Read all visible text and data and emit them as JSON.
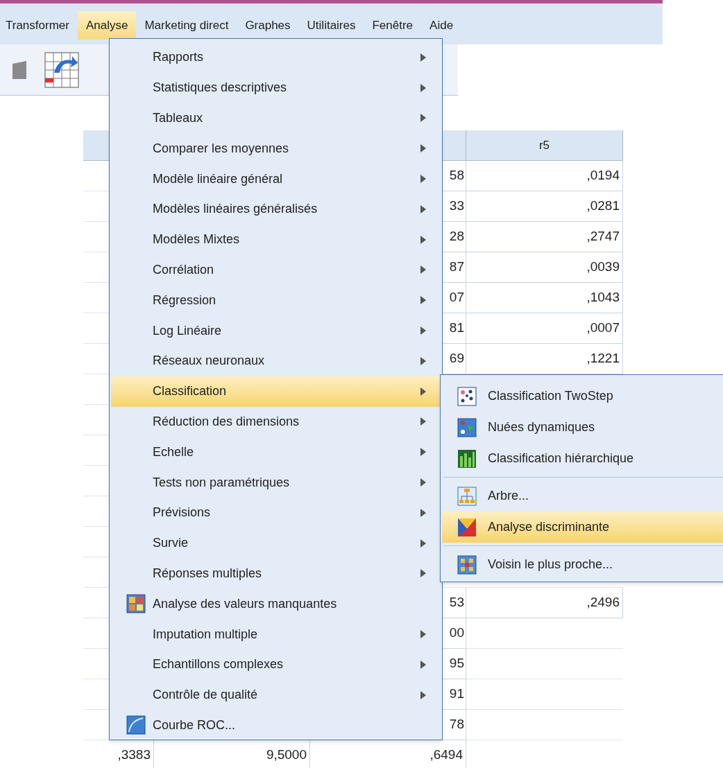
{
  "menu_bar": [
    {
      "label": "Transformer",
      "selected": false
    },
    {
      "label": "Analyse",
      "selected": true
    },
    {
      "label": "Marketing direct",
      "selected": false
    },
    {
      "label": "Graphes",
      "selected": false
    },
    {
      "label": "Utilitaires",
      "selected": false
    },
    {
      "label": "Fenêtre",
      "selected": false
    },
    {
      "label": "Aide",
      "selected": false
    }
  ],
  "grid": {
    "column_4_header": "r5",
    "rows_top": [
      {
        "column_3": "58",
        "column_4": ",0194"
      },
      {
        "column_3": "33",
        "column_4": ",0281"
      },
      {
        "column_3": "28",
        "column_4": ",2747"
      },
      {
        "column_3": "87",
        "column_4": ",0039"
      },
      {
        "column_3": "07",
        "column_4": ",1043"
      },
      {
        "column_3": "81",
        "column_4": ",0007"
      },
      {
        "column_3": "69",
        "column_4": ",1221"
      }
    ],
    "rows_bottom": [
      {
        "column_3": "53",
        "column_4": ",2496"
      },
      {
        "column_3": "00"
      },
      {
        "column_3": "95"
      },
      {
        "column_3": "91"
      },
      {
        "column_3": "78"
      },
      {
        "column_1": ",3383",
        "column_2": "9,5000",
        "column_3": ",6494"
      }
    ]
  },
  "analyse_menu": [
    {
      "label": "Rapports",
      "has_submenu": true,
      "has_icon": false,
      "selected": false
    },
    {
      "label": "Statistiques descriptives",
      "has_submenu": true,
      "has_icon": false,
      "selected": false
    },
    {
      "label": "Tableaux",
      "has_submenu": true,
      "has_icon": false,
      "selected": false
    },
    {
      "label": "Comparer les moyennes",
      "has_submenu": true,
      "has_icon": false,
      "selected": false
    },
    {
      "label": "Modèle linéaire général",
      "has_submenu": true,
      "has_icon": false,
      "selected": false
    },
    {
      "label": "Modèles linéaires généralisés",
      "has_submenu": true,
      "has_icon": false,
      "selected": false
    },
    {
      "label": "Modèles Mixtes",
      "has_submenu": true,
      "has_icon": false,
      "selected": false
    },
    {
      "label": "Corrélation",
      "has_submenu": true,
      "has_icon": false,
      "selected": false
    },
    {
      "label": "Régression",
      "has_submenu": true,
      "has_icon": false,
      "selected": false
    },
    {
      "label": "Log Linéaire",
      "has_submenu": true,
      "has_icon": false,
      "selected": false
    },
    {
      "label": "Réseaux neuronaux",
      "has_submenu": true,
      "has_icon": false,
      "selected": false
    },
    {
      "label": "Classification",
      "has_submenu": true,
      "has_icon": false,
      "selected": true
    },
    {
      "label": "Réduction des dimensions",
      "has_submenu": true,
      "has_icon": false,
      "selected": false
    },
    {
      "label": "Echelle",
      "has_submenu": true,
      "has_icon": false,
      "selected": false
    },
    {
      "label": "Tests non paramétriques",
      "has_submenu": true,
      "has_icon": false,
      "selected": false
    },
    {
      "label": "Prévisions",
      "has_submenu": true,
      "has_icon": false,
      "selected": false
    },
    {
      "label": "Survie",
      "has_submenu": true,
      "has_icon": false,
      "selected": false
    },
    {
      "label": "Réponses multiples",
      "has_submenu": true,
      "has_icon": false,
      "selected": false
    },
    {
      "label": "Analyse des valeurs manquantes",
      "has_submenu": false,
      "has_icon": true,
      "selected": false
    },
    {
      "label": "Imputation multiple",
      "has_submenu": true,
      "has_icon": false,
      "selected": false
    },
    {
      "label": "Echantillons complexes",
      "has_submenu": true,
      "has_icon": false,
      "selected": false
    },
    {
      "label": "Contrôle de qualité",
      "has_submenu": true,
      "has_icon": false,
      "selected": false
    },
    {
      "label": "Courbe ROC...",
      "has_submenu": false,
      "has_icon": true,
      "selected": false
    }
  ],
  "classification_submenu": [
    {
      "kind": "item",
      "label": "Classification TwoStep",
      "selected": false
    },
    {
      "kind": "item",
      "label": "Nuées dynamiques",
      "selected": false
    },
    {
      "kind": "item",
      "label": "Classification hiérarchique",
      "selected": false
    },
    {
      "kind": "separator"
    },
    {
      "kind": "item",
      "label": "Arbre...",
      "selected": false
    },
    {
      "kind": "item",
      "label": "Analyse discriminante",
      "selected": true
    },
    {
      "kind": "separator"
    },
    {
      "kind": "item",
      "label": "Voisin le plus proche...",
      "selected": false
    }
  ]
}
